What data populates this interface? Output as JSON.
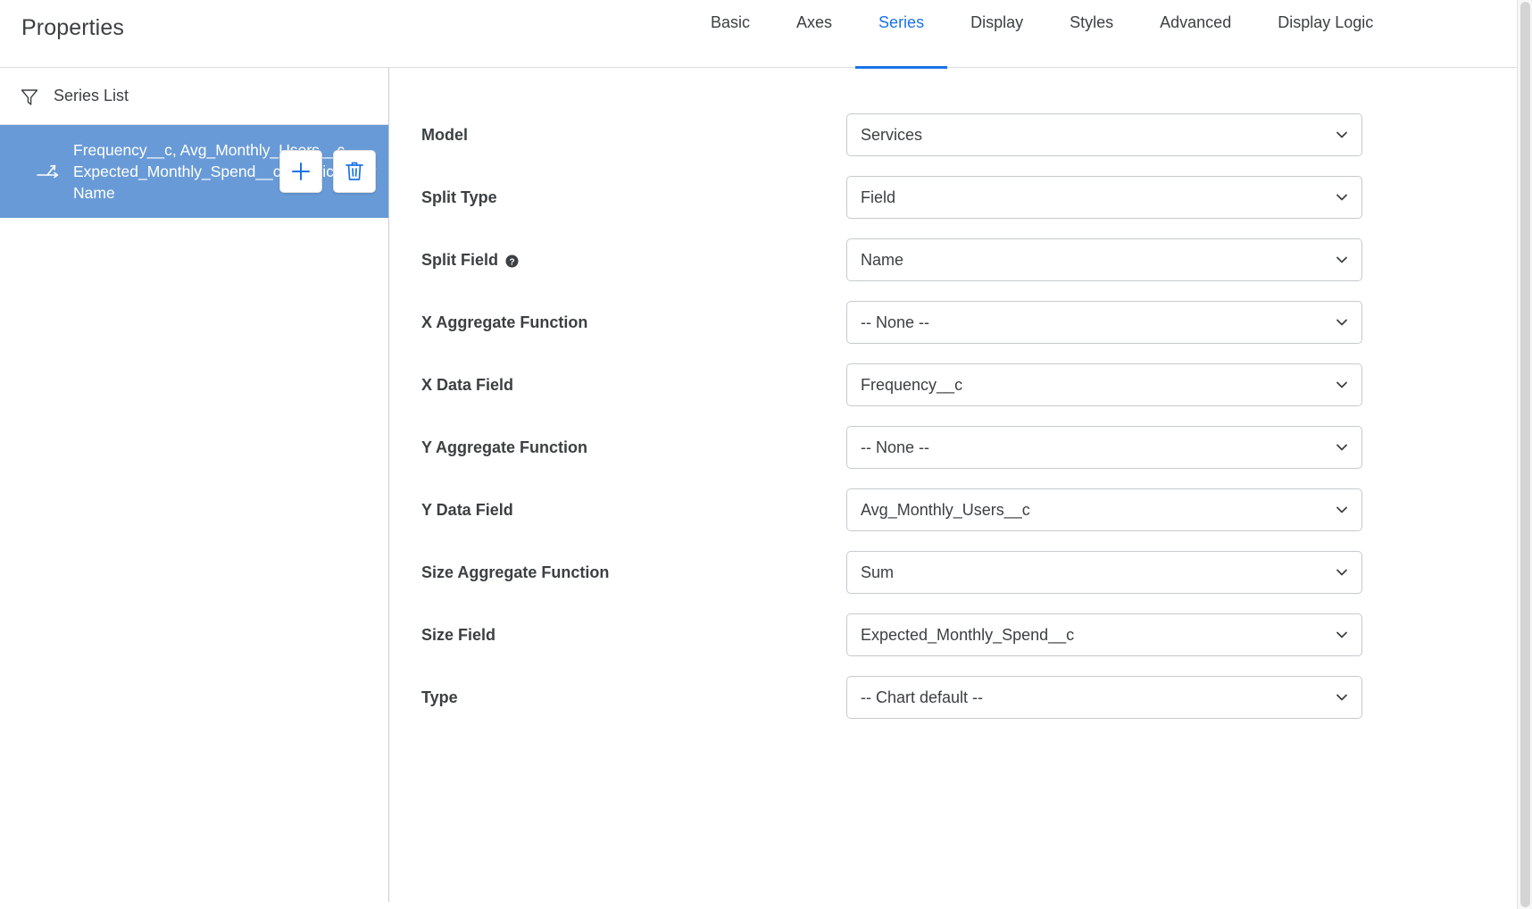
{
  "header": {
    "title": "Properties",
    "tabs": [
      {
        "label": "Basic",
        "active": false
      },
      {
        "label": "Axes",
        "active": false
      },
      {
        "label": "Series",
        "active": true
      },
      {
        "label": "Display",
        "active": false
      },
      {
        "label": "Styles",
        "active": false
      },
      {
        "label": "Advanced",
        "active": false
      },
      {
        "label": "Display Logic",
        "active": false
      }
    ],
    "active_tab": "Series",
    "accent_color": "#1a73e8"
  },
  "sidebar": {
    "filter_icon": "filter-icon",
    "title": "Series List",
    "selected_color": "#689ad7",
    "items": [
      {
        "label": "Frequency__c, Avg_Monthly_Users__c, Expected_Monthly_Spend__c (Services) by Name",
        "selected": true,
        "drag_icon": "move-arrows-icon",
        "add_label": "+",
        "add_icon": "plus-icon",
        "delete_icon": "trash-icon"
      }
    ]
  },
  "form": {
    "fields": [
      {
        "label": "Model",
        "value": "Services",
        "help": false
      },
      {
        "label": "Split Type",
        "value": "Field",
        "help": false
      },
      {
        "label": "Split Field",
        "value": "Name",
        "help": true
      },
      {
        "label": "X Aggregate Function",
        "value": "-- None --",
        "help": false
      },
      {
        "label": "X Data Field",
        "value": "Frequency__c",
        "help": false
      },
      {
        "label": "Y Aggregate Function",
        "value": "-- None --",
        "help": false
      },
      {
        "label": "Y Data Field",
        "value": "Avg_Monthly_Users__c",
        "help": false
      },
      {
        "label": "Size Aggregate Function",
        "value": "Sum",
        "help": false
      },
      {
        "label": "Size Field",
        "value": "Expected_Monthly_Spend__c",
        "help": false
      },
      {
        "label": "Type",
        "value": "-- Chart default --",
        "help": false
      }
    ]
  }
}
